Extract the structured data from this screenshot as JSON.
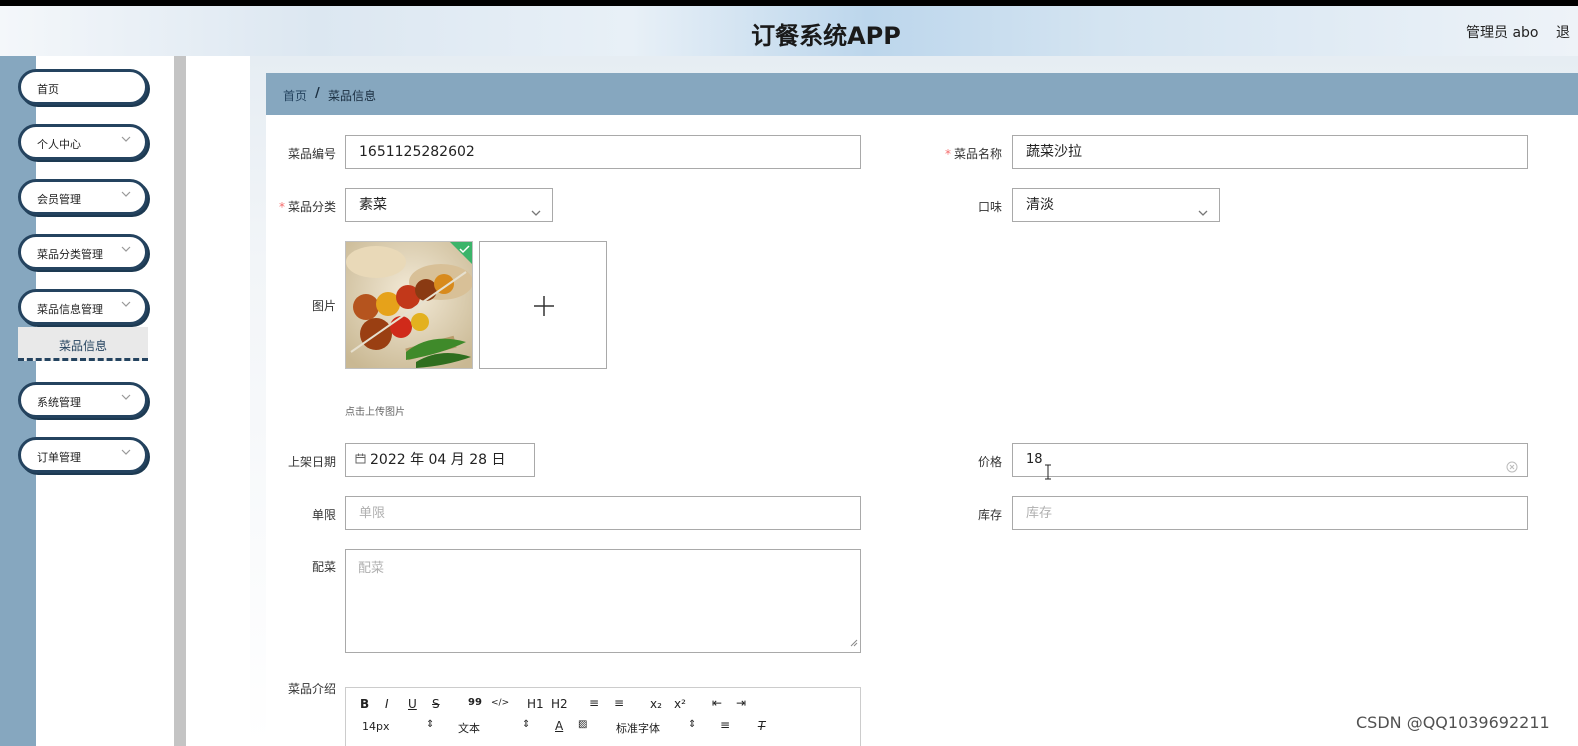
{
  "header": {
    "title": "订餐系统APP",
    "user_label": "管理员 abo",
    "logout_label": "退"
  },
  "sidebar": {
    "items": [
      {
        "label": "首页",
        "has_chevron": false
      },
      {
        "label": "个人中心",
        "has_chevron": true
      },
      {
        "label": "会员管理",
        "has_chevron": true
      },
      {
        "label": "菜品分类管理",
        "has_chevron": true
      },
      {
        "label": "菜品信息管理",
        "has_chevron": true,
        "expanded": true
      },
      {
        "label": "系统管理",
        "has_chevron": true
      },
      {
        "label": "订单管理",
        "has_chevron": true
      }
    ],
    "submenu": {
      "label": "菜品信息"
    }
  },
  "breadcrumb": {
    "home": "首页",
    "separator": "/",
    "current": "菜品信息"
  },
  "form": {
    "dish_code": {
      "label": "菜品编号",
      "value": "1651125282602"
    },
    "dish_name": {
      "label": "菜品名称",
      "required": true,
      "value": "蔬菜沙拉"
    },
    "category": {
      "label": "菜品分类",
      "required": true,
      "value": "素菜"
    },
    "taste": {
      "label": "口味",
      "value": "清淡"
    },
    "image": {
      "label": "图片",
      "tip": "点击上传图片",
      "add_glyph": "+"
    },
    "shelf_date": {
      "label": "上架日期",
      "value": "2022 年 04 月 28 日"
    },
    "price": {
      "label": "价格",
      "value": "18"
    },
    "limit": {
      "label": "单限",
      "placeholder": "单限"
    },
    "stock": {
      "label": "库存",
      "placeholder": "库存"
    },
    "side_dish": {
      "label": "配菜",
      "placeholder": "配菜"
    },
    "intro": {
      "label": "菜品介绍"
    }
  },
  "editor_toolbar": {
    "row1": [
      "B",
      "I",
      "U",
      "S",
      "99",
      "</>",
      "H1",
      "H2",
      "≡",
      "≡",
      "x₂",
      "x²",
      "⇤",
      "⇥"
    ],
    "font_size": "14px",
    "text_style": "文本",
    "font_family": "标准字体"
  },
  "watermark": "CSDN @QQ1039692211",
  "colors": {
    "sidebar_border": "#24435f",
    "breadcrumb_bg": "#86a7bf",
    "required": "#f56c6c",
    "left_strip": "#86a7bf"
  }
}
